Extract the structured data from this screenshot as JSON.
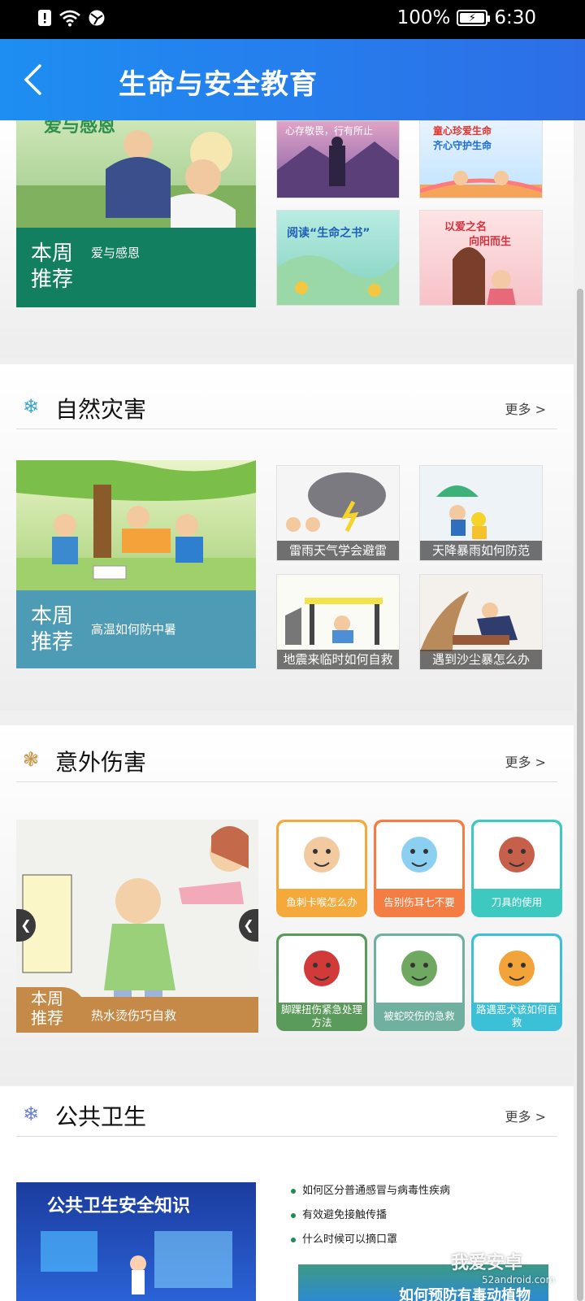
{
  "status": {
    "battery": "100%",
    "time": "6:30",
    "battery_level": 1.0
  },
  "header": {
    "title": "生命与安全教育"
  },
  "life": {
    "feature": {
      "tag_line1": "本周",
      "tag_line2": "推荐",
      "subtitle": "爱与感恩",
      "banner": "爱与感恩"
    },
    "thumbs": [
      "心存敬畏，行有所止",
      "童心珍爱生命 齐心守护生命",
      "阅读“生命之书”",
      "以爱之名 向阳而生"
    ]
  },
  "nature": {
    "title": "自然灾害",
    "more": "更多 >",
    "feature": {
      "tag_line1": "本周",
      "tag_line2": "推荐",
      "subtitle": "高温如何防中暑"
    },
    "thumbs": [
      "雷雨天气学会避雷",
      "天降暴雨如何防范",
      "地震来临时如何自救",
      "遇到沙尘暴怎么办"
    ]
  },
  "accident": {
    "title": "意外伤害",
    "more": "更多 >",
    "feature": {
      "tag_line1": "本周",
      "tag_line2": "推荐",
      "subtitle": "热水烫伤巧自救"
    },
    "tiles": [
      {
        "label": "鱼刺卡喉怎么办",
        "color": "#f4a93a"
      },
      {
        "label": "告别伤耳七不要",
        "color": "#f47d44"
      },
      {
        "label": "刀具的使用",
        "color": "#3ec9c0"
      },
      {
        "label": "脚踝扭伤紧急处理方法",
        "color": "#5a9a5a"
      },
      {
        "label": "被蛇咬伤的急救",
        "color": "#6fb0a0"
      },
      {
        "label": "路遇恶犬该如何自救",
        "color": "#3cc0d8"
      }
    ]
  },
  "public": {
    "title": "公共卫生",
    "more": "更多 >",
    "feature_banner": "公共卫生安全知识",
    "items": [
      "如何区分普通感冒与病毒性疾病",
      "有效避免接触传播",
      "什么时候可以摘口罩"
    ],
    "sub_banner": "如何预防有毒动植物"
  },
  "watermark": {
    "text": "我爱安卓",
    "sub": "52android.com"
  }
}
